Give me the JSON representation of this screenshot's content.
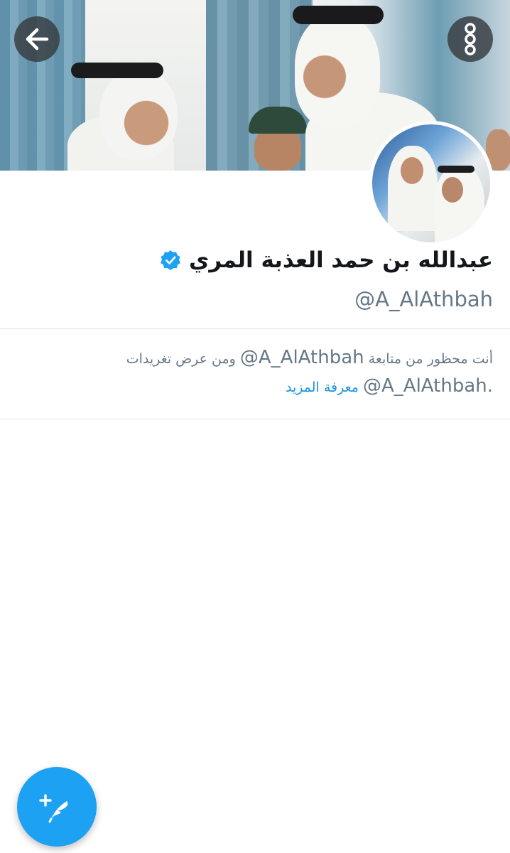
{
  "profile": {
    "display_name": "عبدالله بن حمد العذبة المري",
    "handle": "@A_AlAthbah",
    "verified": true
  },
  "notice": {
    "line1_prefix": "أنت محظور من متابعة",
    "line1_mention": "@A_AlAthbah",
    "line1_suffix": "ومن عرض تغريدات",
    "line2_mention": "@A_AlAthbah.",
    "learn_more": "معرفة المزيد"
  },
  "icons": {
    "back": "arrow-left-icon",
    "more": "more-vertical-icon",
    "verified": "verified-badge-icon",
    "compose": "compose-tweet-icon"
  },
  "colors": {
    "accent": "#1da1f2",
    "link": "#1b95e0",
    "secondary_text": "#657786"
  }
}
